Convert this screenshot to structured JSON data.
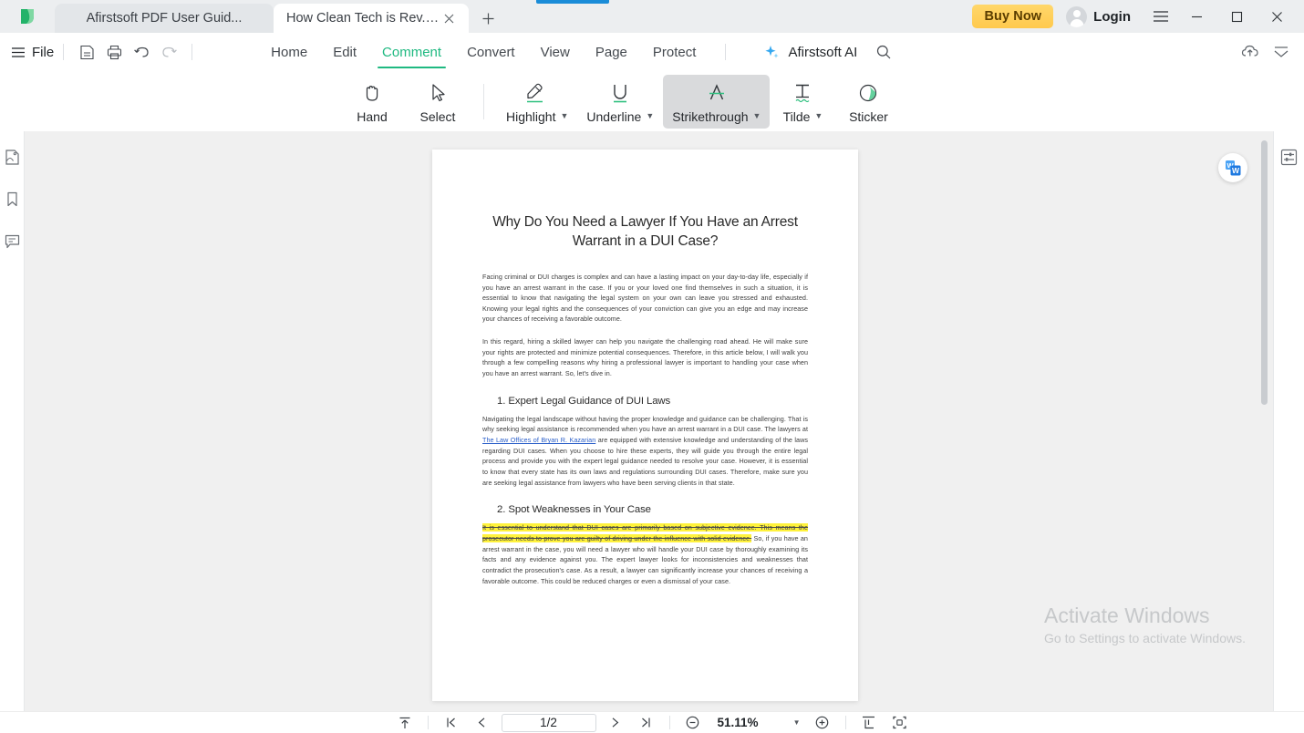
{
  "titlebar": {
    "logo_icon": "afirstsoft-leaf-logo",
    "tabs": [
      {
        "label": "Afirstsoft PDF User Guid...",
        "active": false,
        "modified": false
      },
      {
        "label": "How Clean Tech is Rev... *",
        "active": true,
        "modified": true
      }
    ],
    "new_tab_icon": "plus-icon",
    "close_tab_icon": "close-icon",
    "buy_now_label": "Buy Now",
    "login_label": "Login",
    "avatar_icon": "user-avatar-icon",
    "app_menu_icon": "hamburger-menu-icon",
    "minimize_icon": "minimize-icon",
    "maximize_icon": "maximize-icon",
    "close_icon": "close-window-icon",
    "buy_now_color": "#ffc94d"
  },
  "menubar": {
    "file_label": "File",
    "file_menu_icon": "hamburger-menu-icon",
    "quick_actions": [
      {
        "name": "save-button",
        "icon": "save-icon"
      },
      {
        "name": "print-button",
        "icon": "printer-icon"
      },
      {
        "name": "undo-button",
        "icon": "undo-arrow-icon"
      },
      {
        "name": "redo-button",
        "icon": "redo-arrow-icon"
      }
    ],
    "tabs": [
      {
        "label": "Home",
        "active": false
      },
      {
        "label": "Edit",
        "active": false
      },
      {
        "label": "Comment",
        "active": true
      },
      {
        "label": "Convert",
        "active": false
      },
      {
        "label": "View",
        "active": false
      },
      {
        "label": "Page",
        "active": false
      },
      {
        "label": "Protect",
        "active": false
      }
    ],
    "active_tab_color": "#1fb981",
    "ai_label": "Afirstsoft AI",
    "ai_icon": "sparkle-ai-icon",
    "search_icon": "search-icon",
    "cloud_icon": "cloud-upload-icon",
    "collapse_icon": "collapse-ribbon-icon"
  },
  "ribbon": {
    "tools": [
      {
        "label": "Hand",
        "icon": "hand-icon",
        "has_caret": false,
        "selected": false
      },
      {
        "label": "Select",
        "icon": "cursor-arrow-icon",
        "has_caret": false,
        "selected": false
      },
      {
        "label": "Highlight",
        "icon": "highlighter-pen-icon",
        "has_caret": true,
        "selected": false
      },
      {
        "label": "Underline",
        "icon": "underline-u-icon",
        "has_caret": true,
        "selected": false
      },
      {
        "label": "Strikethrough",
        "icon": "strikethrough-a-icon",
        "has_caret": true,
        "selected": true
      },
      {
        "label": "Tilde",
        "icon": "tilde-t-icon",
        "has_caret": true,
        "selected": false
      },
      {
        "label": "Sticker",
        "icon": "sticker-circle-icon",
        "has_caret": false,
        "selected": false
      }
    ],
    "accent_color": "#1fb981",
    "selected_bg": "#d9dadc"
  },
  "left_rail": {
    "items": [
      {
        "name": "page-thumbnails-panel",
        "icon": "page-thumbnail-icon"
      },
      {
        "name": "bookmarks-panel",
        "icon": "bookmark-icon"
      },
      {
        "name": "comments-panel",
        "icon": "comment-bubble-icon"
      }
    ]
  },
  "right_rail": {
    "items": [
      {
        "name": "properties-panel",
        "icon": "properties-sliders-icon"
      }
    ]
  },
  "viewer": {
    "word_convert_icon": "convert-to-word-icon",
    "watermark_line1": "Activate Windows",
    "watermark_line2": "Go to Settings to activate Windows.",
    "scrollbar_name": "vertical-scrollbar"
  },
  "document": {
    "title": "Why Do You Need a Lawyer If You Have an Arrest Warrant in a DUI Case?",
    "paragraphs": [
      "Facing criminal or DUI charges is complex and can have a lasting impact on your day-to-day life, especially if you have an arrest warrant in the case. If you or your loved one find themselves in such a situation, it is essential to know that navigating the legal system on your own can leave you stressed and exhausted. Knowing your legal rights and the consequences of your conviction can give you an edge and may increase your chances of receiving a favorable outcome.",
      "In this regard, hiring a skilled lawyer can help you navigate the challenging road ahead. He will make sure your rights are protected and minimize potential consequences. Therefore, in this article below, I will walk you through a few compelling reasons why hiring a professional lawyer is important to handling your case when you have an arrest warrant. So, let's dive in."
    ],
    "section1": {
      "heading": "1. Expert Legal Guidance of DUI Laws",
      "text_before_link": "Navigating the legal landscape without having the proper knowledge and guidance can be challenging. That is why seeking legal assistance is recommended when you have an arrest warrant in a DUI case. The lawyers at ",
      "link_text": "The Law Offices of Bryan R. Kazarian",
      "text_after_link": " are equipped with extensive knowledge and understanding of the laws regarding DUI cases. When you choose to hire these experts, they will guide you through the entire legal process and provide you with the expert legal guidance needed to resolve your case. However, it is essential to know that every state has its own laws and regulations surrounding DUI cases. Therefore, make sure you are seeking legal assistance from lawyers who have been serving clients in that state."
    },
    "section2": {
      "heading": "2. Spot Weaknesses in Your Case",
      "highlighted_text": "It is essential to understand that DUI cases are primarily based on subjective evidence. This means the prosecutor needs to prove you are guilty of driving under the influence with solid evidence.",
      "rest_text": " So, if you have an arrest warrant in the case, you will need a lawyer who will handle your DUI case by thoroughly examining its facts and any evidence against you. The expert lawyer looks for inconsistencies and weaknesses that contradict the prosecution's case. As a result, a lawyer can significantly increase your chances of receiving a favorable outcome. This could be reduced charges or even a dismissal of your case."
    },
    "highlight_color": "#fff23d",
    "link_color": "#2b5fc9"
  },
  "bottombar": {
    "scroll_top_icon": "scroll-to-top-icon",
    "first_page_icon": "first-page-icon",
    "prev_page_icon": "previous-page-icon",
    "page_value": "1/2",
    "next_page_icon": "next-page-icon",
    "last_page_icon": "last-page-icon",
    "zoom_out_icon": "zoom-out-icon",
    "zoom_value": "51.11%",
    "zoom_in_icon": "zoom-in-icon",
    "fit_width_icon": "fit-width-icon",
    "fit_page_icon": "fit-page-icon"
  }
}
